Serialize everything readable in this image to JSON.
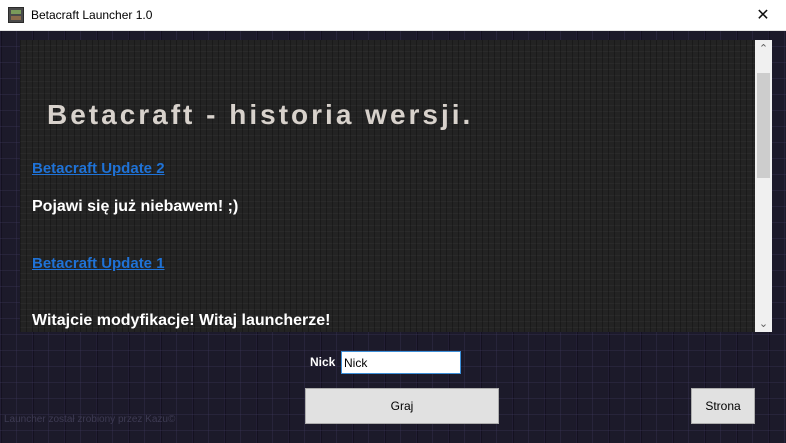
{
  "window": {
    "title": "Betacraft Launcher 1.0",
    "close_glyph": "✕"
  },
  "news": {
    "headline": "Betacraft - historia wersji.",
    "entries": [
      {
        "link": "Betacraft Update 2",
        "text": "Pojawi się już niebawem! ;)"
      },
      {
        "link": "Betacraft Update 1",
        "text": "Witajcie modyfikacje! Witaj launcherze!"
      }
    ]
  },
  "scrollbar": {
    "up_glyph": "⌃",
    "down_glyph": "⌄"
  },
  "login": {
    "nick_label": "Nick",
    "nick_value": "Nick"
  },
  "buttons": {
    "play": "Graj",
    "site": "Strona"
  },
  "footer": {
    "credit": "Launcher został zrobiony przez Kazu©"
  },
  "colors": {
    "link": "#1f72d6",
    "input_border": "#3c8fd8"
  }
}
